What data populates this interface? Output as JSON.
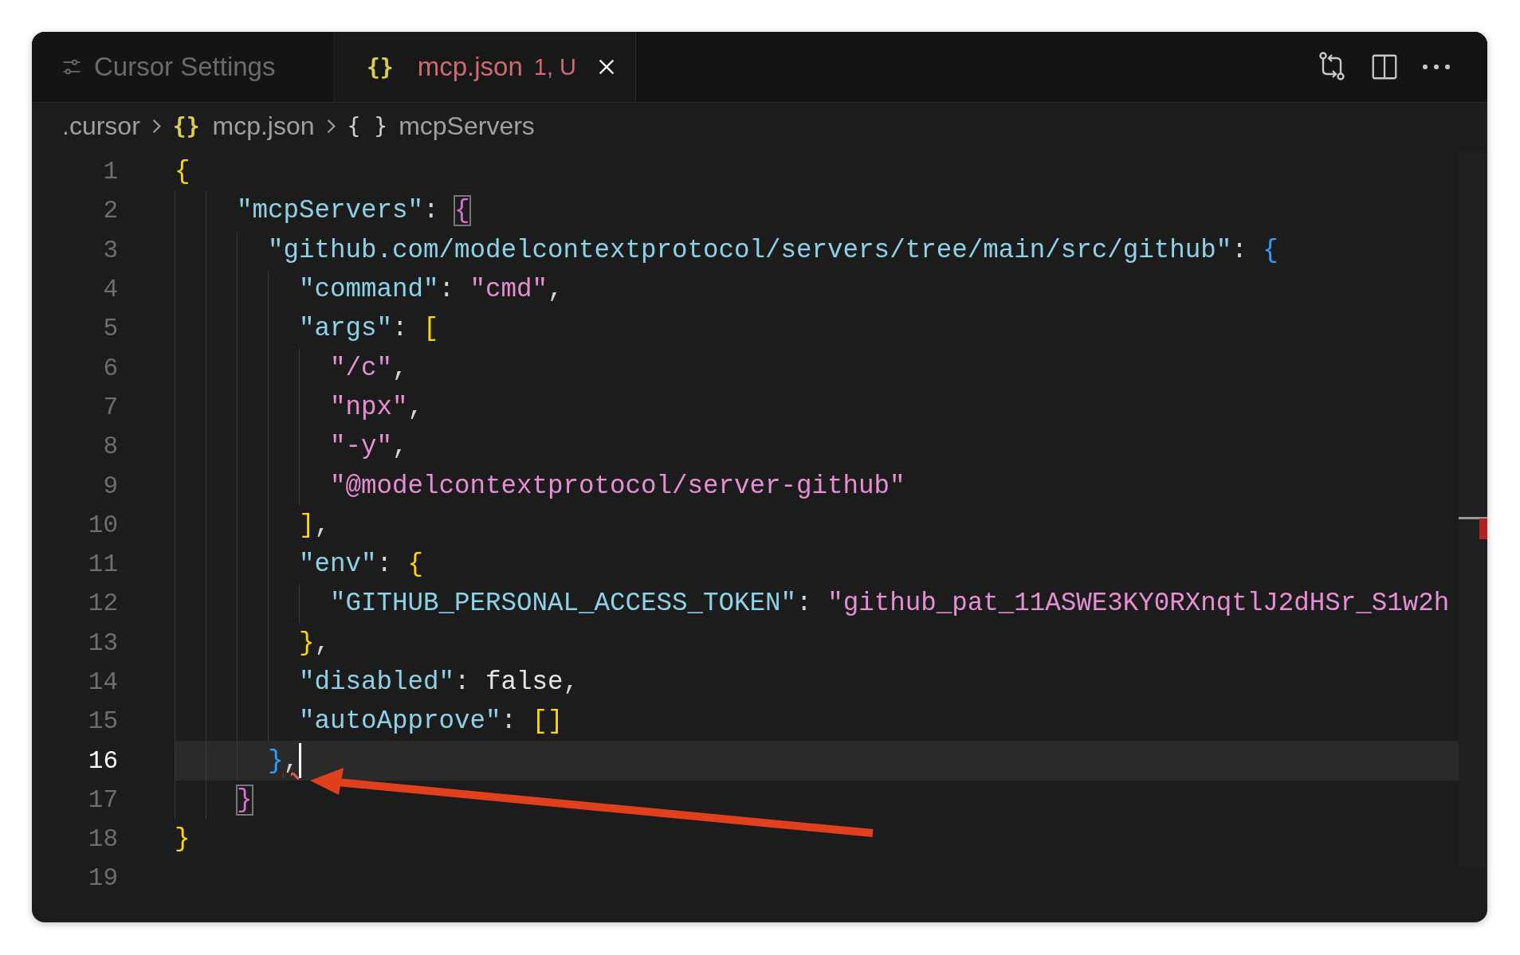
{
  "tabs": [
    {
      "kind": "settings",
      "label": "Cursor Settings",
      "selected": false
    },
    {
      "kind": "file",
      "icon": "{}",
      "label": "mcp.json",
      "badge": "1, U",
      "selected": true
    }
  ],
  "breadcrumb": [
    {
      "kind": "folder",
      "label": ".cursor"
    },
    {
      "kind": "file",
      "icon": "{}",
      "label": "mcp.json"
    },
    {
      "kind": "object",
      "icon": "{ }",
      "label": "mcpServers"
    }
  ],
  "lines": [
    {
      "number": "1",
      "current": false,
      "tokens": [
        {
          "kind": "bracket1",
          "text": "{"
        }
      ]
    },
    {
      "number": "2",
      "current": false,
      "tokens": [
        {
          "kind": "key",
          "text": "\"mcpServers\""
        },
        {
          "kind": "punct",
          "text": ": "
        },
        {
          "kind": "bracket2",
          "text": "{",
          "matched": true
        }
      ]
    },
    {
      "number": "3",
      "current": false,
      "tokens": [
        {
          "kind": "key",
          "text": "\"github.com/modelcontextprotocol/servers/tree/main/src/github\""
        },
        {
          "kind": "punct",
          "text": ": "
        },
        {
          "kind": "bracket3",
          "text": "{"
        }
      ]
    },
    {
      "number": "4",
      "current": false,
      "tokens": [
        {
          "kind": "key",
          "text": "\"command\""
        },
        {
          "kind": "punct",
          "text": ": "
        },
        {
          "kind": "string",
          "text": "\"cmd\""
        },
        {
          "kind": "punct",
          "text": ","
        }
      ]
    },
    {
      "number": "5",
      "current": false,
      "tokens": [
        {
          "kind": "key",
          "text": "\"args\""
        },
        {
          "kind": "punct",
          "text": ": "
        },
        {
          "kind": "bracket1",
          "text": "["
        }
      ]
    },
    {
      "number": "6",
      "current": false,
      "tokens": [
        {
          "kind": "string",
          "text": "\"/c\""
        },
        {
          "kind": "punct",
          "text": ","
        }
      ]
    },
    {
      "number": "7",
      "current": false,
      "tokens": [
        {
          "kind": "string",
          "text": "\"npx\""
        },
        {
          "kind": "punct",
          "text": ","
        }
      ]
    },
    {
      "number": "8",
      "current": false,
      "tokens": [
        {
          "kind": "string",
          "text": "\"-y\""
        },
        {
          "kind": "punct",
          "text": ","
        }
      ]
    },
    {
      "number": "9",
      "current": false,
      "tokens": [
        {
          "kind": "string",
          "text": "\"@modelcontextprotocol/server-github\""
        }
      ]
    },
    {
      "number": "10",
      "current": false,
      "tokens": [
        {
          "kind": "bracket1",
          "text": "]"
        },
        {
          "kind": "punct",
          "text": ","
        }
      ]
    },
    {
      "number": "11",
      "current": false,
      "tokens": [
        {
          "kind": "key",
          "text": "\"env\""
        },
        {
          "kind": "punct",
          "text": ": "
        },
        {
          "kind": "bracket1",
          "text": "{"
        }
      ]
    },
    {
      "number": "12",
      "current": false,
      "tokens": [
        {
          "kind": "key",
          "text": "\"GITHUB_PERSONAL_ACCESS_TOKEN\""
        },
        {
          "kind": "punct",
          "text": ": "
        },
        {
          "kind": "string",
          "text": "\"github_pat_11ASWE3KY0RXnqtlJ2dHSr_S1w2h"
        }
      ]
    },
    {
      "number": "13",
      "current": false,
      "tokens": [
        {
          "kind": "bracket1",
          "text": "}"
        },
        {
          "kind": "punct",
          "text": ","
        }
      ]
    },
    {
      "number": "14",
      "current": false,
      "tokens": [
        {
          "kind": "key",
          "text": "\"disabled\""
        },
        {
          "kind": "punct",
          "text": ": "
        },
        {
          "kind": "literal",
          "text": "false"
        },
        {
          "kind": "punct",
          "text": ","
        }
      ]
    },
    {
      "number": "15",
      "current": false,
      "tokens": [
        {
          "kind": "key",
          "text": "\"autoApprove\""
        },
        {
          "kind": "punct",
          "text": ": "
        },
        {
          "kind": "bracket1",
          "text": "[]"
        }
      ]
    },
    {
      "number": "16",
      "current": true,
      "tokens": [
        {
          "kind": "bracket3",
          "text": "}"
        },
        {
          "kind": "error",
          "text": ","
        }
      ]
    },
    {
      "number": "17",
      "current": false,
      "tokens": [
        {
          "kind": "bracket2",
          "text": "}",
          "matched": true
        }
      ]
    },
    {
      "number": "18",
      "current": false,
      "tokens": [
        {
          "kind": "bracket1",
          "text": "}"
        }
      ]
    },
    {
      "number": "19",
      "current": false
    }
  ]
}
